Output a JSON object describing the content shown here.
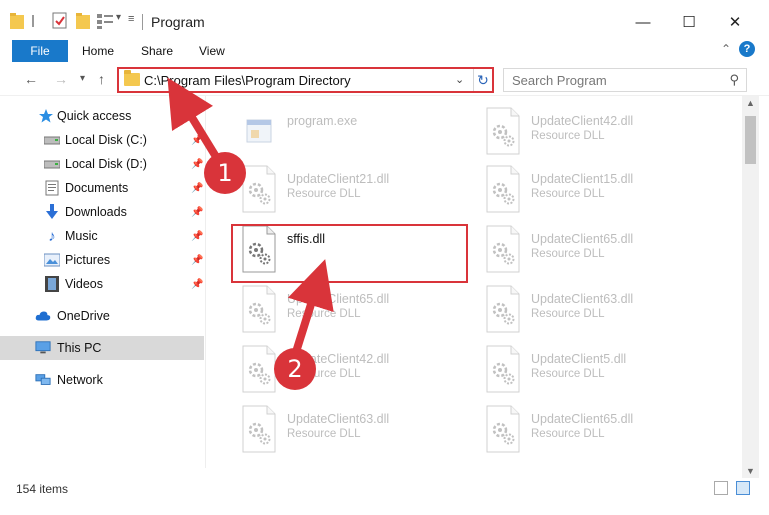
{
  "window": {
    "title": "Program",
    "minimize": "—",
    "maximize": "☐",
    "close": "✕"
  },
  "ribbon": {
    "tabs": [
      "File",
      "Home",
      "Share",
      "View"
    ],
    "help": "?"
  },
  "address": {
    "path": "C:\\Program Files\\Program Directory",
    "search_placeholder": "Search Program"
  },
  "sidebar": {
    "items": [
      {
        "label": "Quick access",
        "icon": "star-icon"
      },
      {
        "label": "Local Disk (C:)",
        "icon": "drive-icon",
        "pinned": true
      },
      {
        "label": "Local Disk (D:)",
        "icon": "drive-icon",
        "pinned": true
      },
      {
        "label": "Documents",
        "icon": "documents-icon",
        "pinned": true
      },
      {
        "label": "Downloads",
        "icon": "downloads-icon",
        "pinned": true
      },
      {
        "label": "Music",
        "icon": "music-icon",
        "pinned": true
      },
      {
        "label": "Pictures",
        "icon": "pictures-icon",
        "pinned": true
      },
      {
        "label": "Videos",
        "icon": "videos-icon",
        "pinned": true
      },
      {
        "label": "OneDrive",
        "icon": "cloud-icon"
      },
      {
        "label": "This PC",
        "icon": "computer-icon",
        "selected": true
      },
      {
        "label": "Network",
        "icon": "network-icon"
      }
    ]
  },
  "files": [
    {
      "name": "program.exe",
      "type": "",
      "faded": true,
      "kind": "exe"
    },
    {
      "name": "UpdateClient42.dll",
      "type": "Resource DLL",
      "faded": true,
      "kind": "dll"
    },
    {
      "name": "UpdateClient21.dll",
      "type": "Resource DLL",
      "faded": true,
      "kind": "dll"
    },
    {
      "name": "UpdateClient15.dll",
      "type": "Resource DLL",
      "faded": true,
      "kind": "dll"
    },
    {
      "name": "sffis.dll",
      "type": "",
      "faded": false,
      "kind": "dll"
    },
    {
      "name": "UpdateClient65.dll",
      "type": "Resource DLL",
      "faded": true,
      "kind": "dll"
    },
    {
      "name": "UpdateClient65.dll",
      "type": "Resource DLL",
      "faded": true,
      "kind": "dll"
    },
    {
      "name": "UpdateClient63.dll",
      "type": "Resource DLL",
      "faded": true,
      "kind": "dll"
    },
    {
      "name": "UpdateClient42.dll",
      "type": "Resource DLL",
      "faded": true,
      "kind": "dll"
    },
    {
      "name": "UpdateClient5.dll",
      "type": "Resource DLL",
      "faded": true,
      "kind": "dll"
    },
    {
      "name": "UpdateClient63.dll",
      "type": "Resource DLL",
      "faded": true,
      "kind": "dll"
    },
    {
      "name": "UpdateClient65.dll",
      "type": "Resource DLL",
      "faded": true,
      "kind": "dll"
    }
  ],
  "status": {
    "item_count": "154 items"
  },
  "annotations": {
    "step1": "1",
    "step2": "2",
    "color": "#d9343a"
  }
}
